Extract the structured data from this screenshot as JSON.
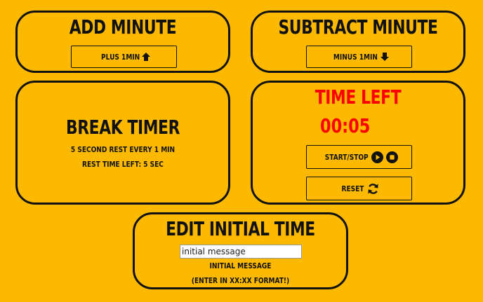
{
  "add_minute": {
    "title": "Add Minute",
    "button_label": "Plus 1min"
  },
  "subtract_minute": {
    "title": "Subtract Minute",
    "button_label": "Minus 1min"
  },
  "break_timer": {
    "title": "Break Timer",
    "line1": "5 second rest every 1 min",
    "line2": "Rest time left: 5 sec"
  },
  "time_left": {
    "title": "Time Left",
    "value": "00:05",
    "start_stop_label": "Start/Stop",
    "reset_label": "Reset"
  },
  "edit_initial_time": {
    "title": "Edit Initial Time",
    "input_value": "initial message",
    "message": "Initial Message",
    "hint": "(Enter in XX:XX format!)"
  },
  "colors": {
    "background": "#fcb900",
    "accent_red": "#ff0000",
    "ink": "#111111"
  },
  "icons": [
    "arrow-up-icon",
    "arrow-down-icon",
    "play-icon",
    "stop-icon",
    "refresh-icon"
  ]
}
